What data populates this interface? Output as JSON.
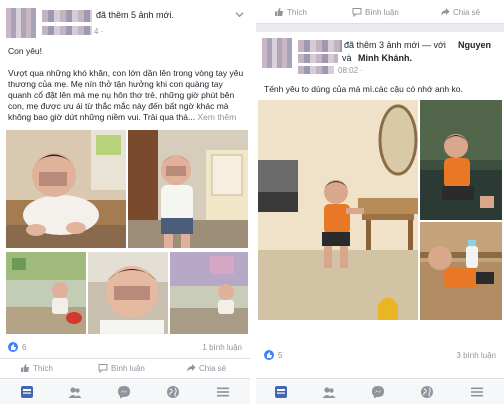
{
  "left_post": {
    "header_suffix": "đã thêm 5 ảnh mới.",
    "date_fragment": "4 ·",
    "caption_title": "Con yêu!",
    "caption_body": "Vượt qua những khó khăn, con lớn dần lên trong vòng tay yêu thương của mẹ. Mẹ nín thở tận hưởng khi con quàng tay quanh cổ đặt lên má mẹ nụ hôn thơ trẻ, những giờ phút bên con, mẹ được ưu ái từ thắc mắc này đến bất ngờ khác mà không bao giờ dứt những niềm vui. Trải qua thá...",
    "see_more": "Xem thêm",
    "likes_count": "6",
    "comments_count": "1 bình luận",
    "actions": {
      "like": "Thích",
      "comment": "Bình luận",
      "share": "Chia sẻ"
    }
  },
  "right_post": {
    "top_actions": {
      "like": "Thích",
      "comment": "Bình luận",
      "share": "Chia sẻ"
    },
    "header_suffix": "đã thêm 3 ảnh mới — với",
    "tagged_1": "Nguyen",
    "tagged_joiner": "và",
    "tagged_2": "Minh Khánh.",
    "time": "08:02 ·",
    "caption": "Tếnh yêu to dùng của má mì.các cậu có nhớ anh ko.",
    "likes_count": "5",
    "comments_count": "3 bình luận",
    "actions": {
      "like": "Thích",
      "comment": "Bình luận",
      "share": "Chia sẻ"
    }
  },
  "tab_icons": [
    "news-feed-icon",
    "friends-icon",
    "messenger-icon",
    "globe-icon",
    "menu-icon"
  ],
  "colors": {
    "accent": "#4267b2",
    "like": "#4080ff",
    "muted": "#90949c",
    "bg": "#e9ebee"
  }
}
